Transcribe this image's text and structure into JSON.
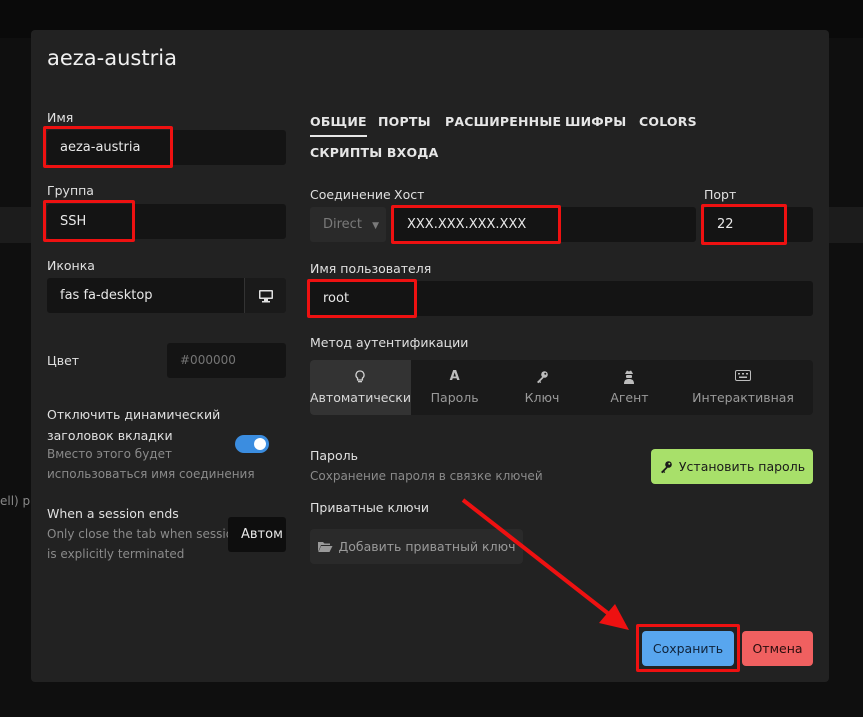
{
  "background": {
    "fragment_text": "ell)   p"
  },
  "dialog": {
    "title": "aeza-austria",
    "left": {
      "name_label": "Имя",
      "name_value": "aeza-austria",
      "group_label": "Группа",
      "group_value": "SSH",
      "icon_label": "Иконка",
      "icon_value": "fas fa-desktop",
      "color_label": "Цвет",
      "color_placeholder": "#000000",
      "dynamic_title_label_1": "Отключить динамический",
      "dynamic_title_label_2": "заголовок вкладки",
      "dynamic_title_sub_1": "Вместо этого будет",
      "dynamic_title_sub_2": "использоваться имя соединения",
      "dynamic_title_enabled": true,
      "session_end_label": "When a session ends",
      "session_end_sub_1": "Only close the tab when session",
      "session_end_sub_2": "is explicitly terminated",
      "session_end_value": "Автом"
    },
    "tabs": [
      {
        "label": "ОБЩИЕ",
        "active": true
      },
      {
        "label": "ПОРТЫ",
        "active": false
      },
      {
        "label": "РАСШИРЕННЫЕ",
        "active": false
      },
      {
        "label": "ШИФРЫ",
        "active": false
      },
      {
        "label": "COLORS",
        "active": false
      },
      {
        "label": "СКРИПТЫ ВХОДА",
        "active": false
      }
    ],
    "connection": {
      "connection_label": "Соединение",
      "connection_value": "Direct",
      "host_label": "Хост",
      "host_value": "XXX.XXX.XXX.XXX",
      "port_label": "Порт",
      "port_value": "22",
      "username_label": "Имя пользователя",
      "username_value": "root"
    },
    "auth": {
      "label": "Метод аутентификации",
      "options": [
        {
          "label": "Автоматически",
          "icon": "lightbulb-icon",
          "active": true
        },
        {
          "label": "Пароль",
          "icon": "font-a-icon",
          "active": false
        },
        {
          "label": "Ключ",
          "icon": "key-icon",
          "active": false
        },
        {
          "label": "Агент",
          "icon": "user-secret-icon",
          "active": false
        },
        {
          "label": "Интерактивная",
          "icon": "keyboard-icon",
          "active": false
        }
      ]
    },
    "password": {
      "label": "Пароль",
      "sub": "Сохранение пароля в связке ключей",
      "set_button": "Установить пароль"
    },
    "private_keys": {
      "label": "Приватные ключи",
      "add_button": "Добавить приватный ключ"
    },
    "footer": {
      "save": "Сохранить",
      "cancel": "Отмена"
    }
  },
  "colors": {
    "accent_blue": "#58a6ef",
    "green_button": "#a8e06a",
    "red_button": "#f06060",
    "annotation_red": "#ee1111"
  }
}
